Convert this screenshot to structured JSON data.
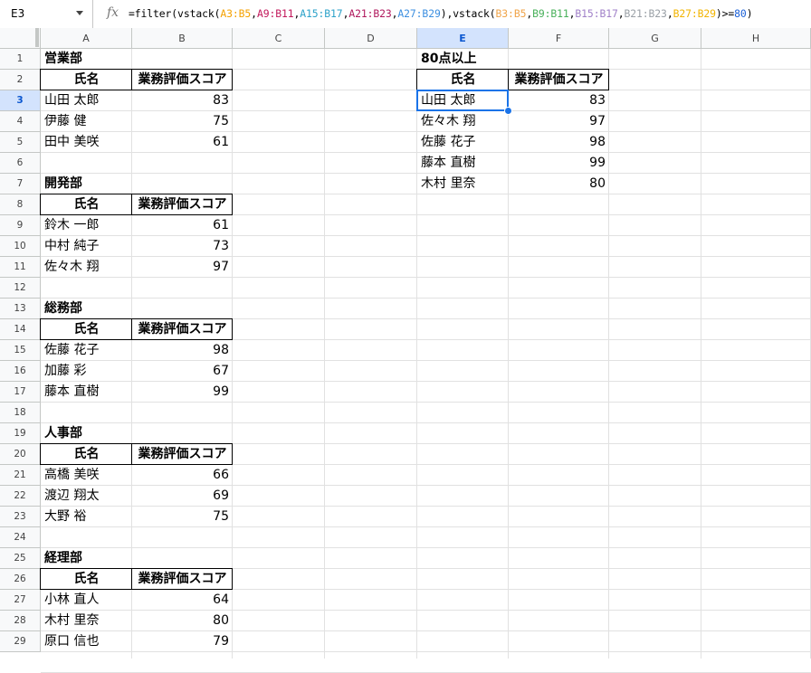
{
  "name_box": "E3",
  "formula_tokens": [
    {
      "t": "=filter(vstack(",
      "c": ""
    },
    {
      "t": "A3:B5",
      "c": "r1"
    },
    {
      "t": ",",
      "c": ""
    },
    {
      "t": "A9:B11",
      "c": "r2"
    },
    {
      "t": ",",
      "c": ""
    },
    {
      "t": "A15:B17",
      "c": "r3"
    },
    {
      "t": ",",
      "c": ""
    },
    {
      "t": "A21:B23",
      "c": "r4"
    },
    {
      "t": ",",
      "c": ""
    },
    {
      "t": "A27:B29",
      "c": "r5"
    },
    {
      "t": "),vstack(",
      "c": ""
    },
    {
      "t": "B3:B5",
      "c": "r6"
    },
    {
      "t": ",",
      "c": ""
    },
    {
      "t": "B9:B11",
      "c": "r7"
    },
    {
      "t": ",",
      "c": ""
    },
    {
      "t": "B15:B17",
      "c": "r8"
    },
    {
      "t": ",",
      "c": ""
    },
    {
      "t": "B21:B23",
      "c": "r9"
    },
    {
      "t": ",",
      "c": ""
    },
    {
      "t": "B27:B29",
      "c": "r10"
    },
    {
      "t": ")>=",
      "c": ""
    },
    {
      "t": "80",
      "c": "r11"
    },
    {
      "t": ")",
      "c": ""
    }
  ],
  "columns": [
    "A",
    "B",
    "C",
    "D",
    "E",
    "F",
    "G",
    "H"
  ],
  "selected_column": "E",
  "rows": [
    "1",
    "2",
    "3",
    "4",
    "5",
    "6",
    "7",
    "8",
    "9",
    "10",
    "11",
    "12",
    "13",
    "14",
    "15",
    "16",
    "17",
    "18",
    "19",
    "20",
    "21",
    "22",
    "23",
    "24",
    "25",
    "26",
    "27",
    "28",
    "29"
  ],
  "selected_row": "3",
  "header_name": "氏名",
  "header_score": "業務評価スコア",
  "departments": [
    {
      "title": "営業部",
      "rows": [
        [
          "山田 太郎",
          "83"
        ],
        [
          "伊藤 健",
          "75"
        ],
        [
          "田中 美咲",
          "61"
        ]
      ]
    },
    {
      "title": "開発部",
      "rows": [
        [
          "鈴木 一郎",
          "61"
        ],
        [
          "中村 純子",
          "73"
        ],
        [
          "佐々木 翔",
          "97"
        ]
      ]
    },
    {
      "title": "総務部",
      "rows": [
        [
          "佐藤 花子",
          "98"
        ],
        [
          "加藤 彩",
          "67"
        ],
        [
          "藤本 直樹",
          "99"
        ]
      ]
    },
    {
      "title": "人事部",
      "rows": [
        [
          "高橋 美咲",
          "66"
        ],
        [
          "渡辺 翔太",
          "69"
        ],
        [
          "大野 裕",
          "75"
        ]
      ]
    },
    {
      "title": "経理部",
      "rows": [
        [
          "小林 直人",
          "64"
        ],
        [
          "木村 里奈",
          "80"
        ],
        [
          "原口 信也",
          "79"
        ]
      ]
    }
  ],
  "result": {
    "title": "80点以上",
    "header_name": "氏名",
    "header_score": "業務評価スコア",
    "rows": [
      [
        "山田 太郎",
        "83"
      ],
      [
        "佐々木 翔",
        "97"
      ],
      [
        "佐藤 花子",
        "98"
      ],
      [
        "藤本 直樹",
        "99"
      ],
      [
        "木村 里奈",
        "80"
      ]
    ]
  },
  "colors": {
    "selection": "#1a73e8",
    "header_selected_bg": "#d3e3fd"
  }
}
